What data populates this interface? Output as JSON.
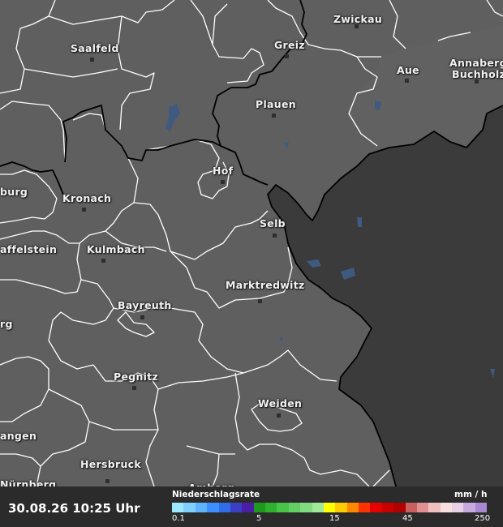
{
  "map": {
    "colors": {
      "land": "#5f5f5f",
      "foreign": "#3b3b3b",
      "water": "#3f5a80",
      "borders": "#ffffff",
      "national_border": "#000000"
    },
    "cities": [
      {
        "name": "Saalfeld"
      },
      {
        "name": "Greiz"
      },
      {
        "name": "Zwickau"
      },
      {
        "name": "Aue"
      },
      {
        "name": "Annaberg-"
      },
      {
        "name": "Buchholz"
      },
      {
        "name": "Plauen"
      },
      {
        "name": "Hof"
      },
      {
        "name": "Kronach"
      },
      {
        "name": "burg"
      },
      {
        "name": "Selb"
      },
      {
        "name": "affelstein"
      },
      {
        "name": "Kulmbach"
      },
      {
        "name": "Marktredwitz"
      },
      {
        "name": "Bayreuth"
      },
      {
        "name": "rg"
      },
      {
        "name": "Pegnitz"
      },
      {
        "name": "Weiden"
      },
      {
        "name": "angen"
      },
      {
        "name": "Hersbruck"
      },
      {
        "name": "Nürnberg"
      },
      {
        "name": "Amberg"
      }
    ]
  },
  "footer": {
    "timestamp": "30.08.26 10:25 Uhr",
    "legend": {
      "title": "Niederschlagsrate",
      "unit": "mm / h",
      "ticks": [
        "0.1",
        "5",
        "15",
        "45",
        "250"
      ],
      "colors": [
        "#9be8ff",
        "#7fcfff",
        "#5fb4ff",
        "#3d8fff",
        "#2f6ee8",
        "#3a3fc4",
        "#4a1fa8",
        "#1d9a1d",
        "#2fb02f",
        "#48c448",
        "#62d062",
        "#80dc80",
        "#a0e89a",
        "#ffff00",
        "#ffcc00",
        "#ff8800",
        "#ff3300",
        "#e60000",
        "#c80000",
        "#b00000",
        "#c86060",
        "#e09090",
        "#f0c0c0",
        "#f8e0e0",
        "#e8d0e8",
        "#c8a8e0",
        "#a888d0"
      ]
    }
  }
}
